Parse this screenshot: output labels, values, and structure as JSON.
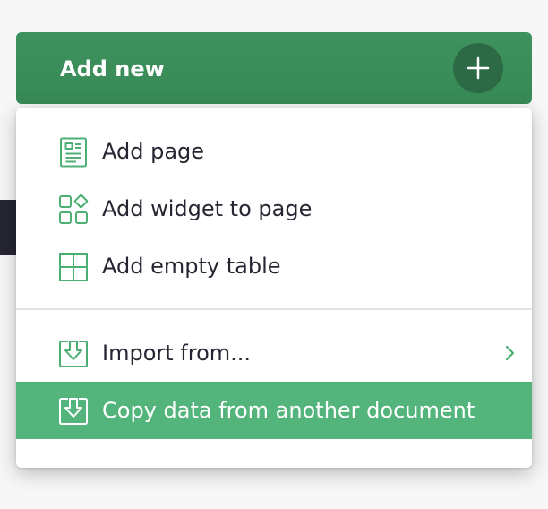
{
  "button": {
    "label": "Add new",
    "icon": "plus-icon"
  },
  "menu": {
    "items": [
      {
        "label": "Add page",
        "icon": "page-icon"
      },
      {
        "label": "Add widget to page",
        "icon": "widget-icon"
      },
      {
        "label": "Add empty table",
        "icon": "table-icon"
      },
      {
        "label": "Import from...",
        "icon": "import-icon",
        "submenu_icon": "chevron-right-icon"
      },
      {
        "label": "Copy data from another document",
        "icon": "import-icon",
        "highlighted": true
      }
    ]
  },
  "colors": {
    "button_bg": "#3e925e",
    "plus_circle": "#2c6a45",
    "highlight": "#53b47c",
    "icon_green": "#4caf74",
    "text": "#262633"
  }
}
